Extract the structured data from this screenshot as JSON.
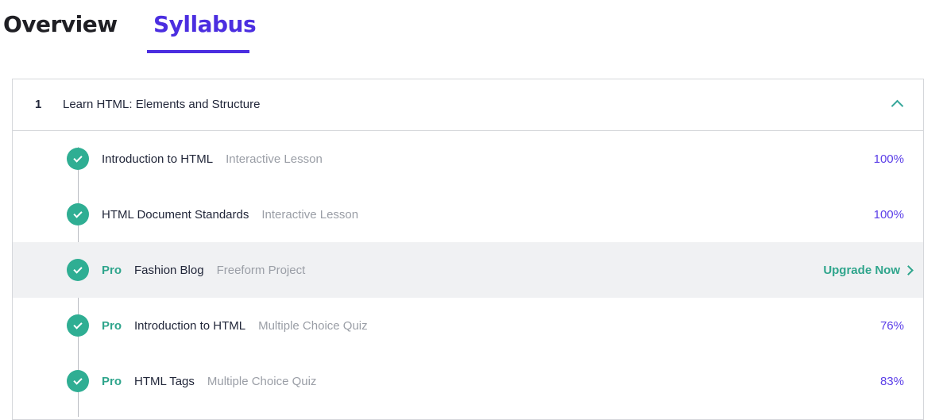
{
  "tabs": {
    "overview": "Overview",
    "syllabus": "Syllabus",
    "active": "Syllabus"
  },
  "module": {
    "number": "1",
    "title": "Learn HTML: Elements and Structure",
    "expanded": true
  },
  "items": [
    {
      "pro": "",
      "title": "Introduction to HTML",
      "type": "Interactive Lesson",
      "status": "100%",
      "completed": true
    },
    {
      "pro": "",
      "title": "HTML Document Standards",
      "type": "Interactive Lesson",
      "status": "100%",
      "completed": true
    },
    {
      "pro": "Pro",
      "title": "Fashion Blog",
      "type": "Freeform Project",
      "action": "Upgrade Now",
      "completed": true
    },
    {
      "pro": "Pro",
      "title": "Introduction to HTML",
      "type": "Multiple Choice Quiz",
      "status": "76%",
      "completed": true
    },
    {
      "pro": "Pro",
      "title": "HTML Tags",
      "type": "Multiple Choice Quiz",
      "status": "83%",
      "completed": true
    }
  ],
  "colors": {
    "accent": "#4b2ee0",
    "success": "#2fae93",
    "percent": "#5b3ee8",
    "highlight_row": "#f0f1f3"
  },
  "icons": {
    "check": "check-circle-icon",
    "collapse": "chevron-up-icon",
    "upgrade": "chevron-right-icon"
  }
}
